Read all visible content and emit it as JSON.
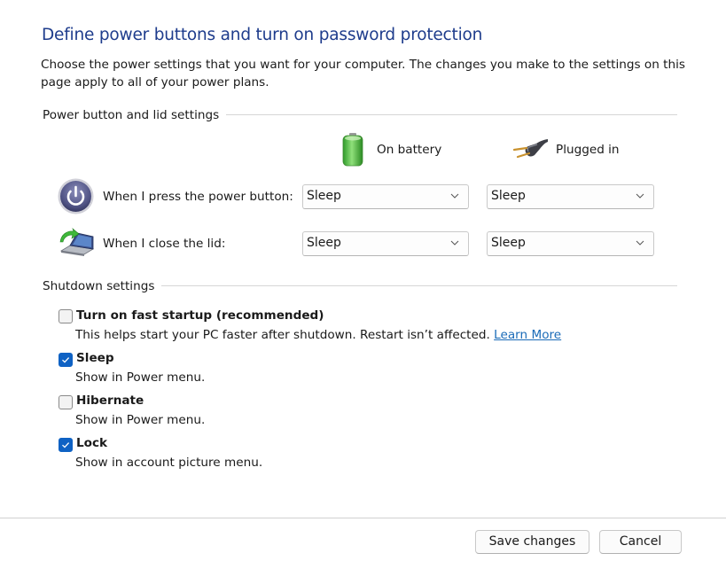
{
  "page": {
    "title": "Define power buttons and turn on password protection",
    "description": "Choose the power settings that you want for your computer. The changes you make to the settings on this page apply to all of your power plans."
  },
  "power_section": {
    "label": "Power button and lid settings",
    "columns": [
      {
        "label": "On battery",
        "icon": "battery-icon"
      },
      {
        "label": "Plugged in",
        "icon": "power-plug-icon"
      }
    ],
    "rows": [
      {
        "label": "When I press the power button:",
        "icon": "power-button-icon",
        "on_battery": "Sleep",
        "plugged_in": "Sleep"
      },
      {
        "label": "When I close the lid:",
        "icon": "laptop-lid-icon",
        "on_battery": "Sleep",
        "plugged_in": "Sleep"
      }
    ]
  },
  "shutdown_section": {
    "label": "Shutdown settings",
    "options": [
      {
        "title": "Turn on fast startup (recommended)",
        "description": "This helps start your PC faster after shutdown. Restart isn’t affected.",
        "link": "Learn More",
        "checked": false
      },
      {
        "title": "Sleep",
        "description": "Show in Power menu.",
        "checked": true
      },
      {
        "title": "Hibernate",
        "description": "Show in Power menu.",
        "checked": false
      },
      {
        "title": "Lock",
        "description": "Show in account picture menu.",
        "checked": true
      }
    ]
  },
  "footer": {
    "save_label": "Save changes",
    "cancel_label": "Cancel"
  },
  "colors": {
    "title": "#1e3c8c",
    "checkbox_checked": "#0f62c4",
    "link": "#1a6bb8"
  }
}
